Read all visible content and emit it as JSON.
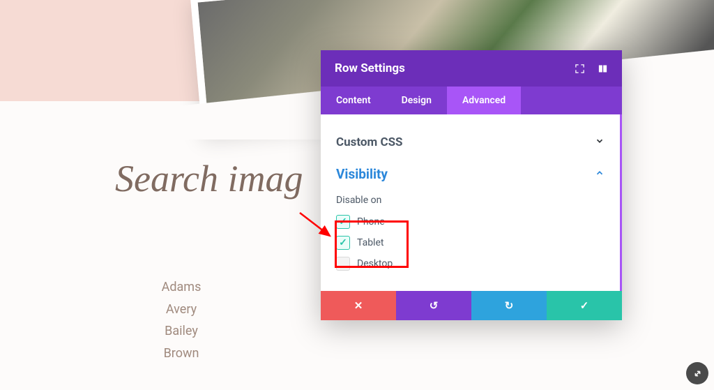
{
  "page": {
    "search_heading": "Search imag",
    "names": [
      "Adams",
      "Avery",
      "Bailey",
      "Brown"
    ]
  },
  "modal": {
    "title": "Row Settings",
    "tabs": {
      "content": "Content",
      "design": "Design",
      "advanced": "Advanced"
    },
    "sections": {
      "custom_css": {
        "title": "Custom CSS"
      },
      "visibility": {
        "title": "Visibility",
        "disable_on_label": "Disable on",
        "options": {
          "phone": {
            "label": "Phone",
            "checked": true
          },
          "tablet": {
            "label": "Tablet",
            "checked": true
          },
          "desktop": {
            "label": "Desktop",
            "checked": false
          }
        }
      }
    },
    "footer": {
      "close": "✕",
      "undo": "↺",
      "redo": "↻",
      "save": "✓"
    }
  }
}
